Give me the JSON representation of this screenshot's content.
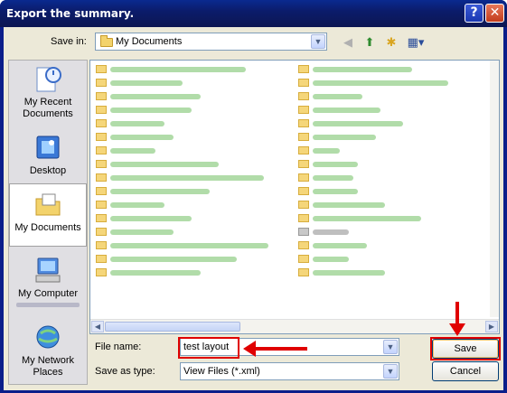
{
  "window": {
    "title": "Export the summary."
  },
  "titlebar_buttons": {
    "help": "?",
    "close": "✕"
  },
  "save_in": {
    "label": "Save in:",
    "value": "My Documents"
  },
  "toolbar": {
    "back": "back-icon",
    "up": "up-folder-icon",
    "new_folder": "new-folder-icon",
    "views": "views-menu-icon"
  },
  "places": [
    {
      "label": "My Recent\nDocuments",
      "icon": "recent-documents-icon"
    },
    {
      "label": "Desktop",
      "icon": "desktop-icon"
    },
    {
      "label": "My Documents",
      "icon": "my-documents-icon",
      "selected": true
    },
    {
      "label": "My Computer",
      "icon": "my-computer-icon"
    },
    {
      "label": "My Network\nPlaces",
      "icon": "network-places-icon"
    }
  ],
  "file_name": {
    "label": "File name:",
    "value": "test layout"
  },
  "save_as_type": {
    "label": "Save as type:",
    "value": "View Files (*.xml)"
  },
  "buttons": {
    "save": "Save",
    "cancel": "Cancel"
  },
  "colors": {
    "title_bar": "#0b1c6b",
    "annotation": "#e00000",
    "dialog_bg": "#ece9d8"
  }
}
